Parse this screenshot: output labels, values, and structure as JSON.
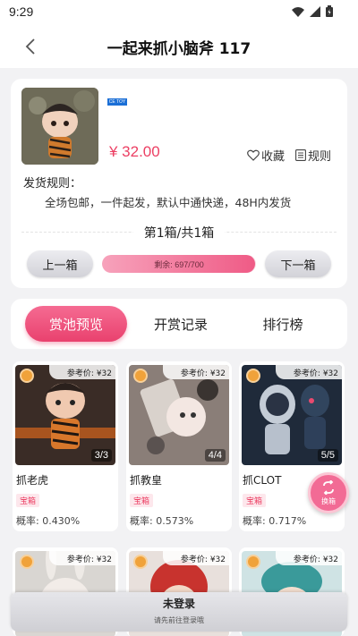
{
  "status": {
    "time": "9:29"
  },
  "header": {
    "title": "一起来抓小脑斧 117",
    "back_icon": "chevron-left-icon"
  },
  "product": {
    "brand": "CE TOY",
    "price": "¥ 32.00",
    "favorite_label": "收藏",
    "rules_label": "规则",
    "shipping_label": "发货规则：",
    "shipping_text": "全场包邮，一件起发，默认中通快递，48H内发货",
    "box_info": "第1箱/共1箱",
    "prev_label": "上一箱",
    "next_label": "下一箱",
    "remaining_text": "剩余: 697/700",
    "remaining_fraction": 0.9957
  },
  "tabs": [
    {
      "label": "赏池预览",
      "active": true
    },
    {
      "label": "开赏记录",
      "active": false
    },
    {
      "label": "排行榜",
      "active": false
    }
  ],
  "prizes": [
    {
      "ref": "参考价: ¥32",
      "count": "3/3",
      "name": "抓老虎",
      "tag": "宝箱",
      "prob": "概率: 0.430%"
    },
    {
      "ref": "参考价: ¥32",
      "count": "4/4",
      "name": "抓教皇",
      "tag": "宝箱",
      "prob": "概率: 0.573%"
    },
    {
      "ref": "参考价: ¥32",
      "count": "5/5",
      "name": "抓CLOT",
      "tag": "宝箱",
      "prob": "概率: 0.717%"
    },
    {
      "ref": "参考价: ¥32"
    },
    {
      "ref": "参考价: ¥32"
    },
    {
      "ref": "参考价: ¥32"
    }
  ],
  "swap_button": {
    "label": "换箱"
  },
  "login": {
    "title": "未登录",
    "subtitle": "请先前往登录哦"
  },
  "colors": {
    "accent": "#ec3f63",
    "tab_active": "#e9416e",
    "badge": "#f0a23a"
  }
}
